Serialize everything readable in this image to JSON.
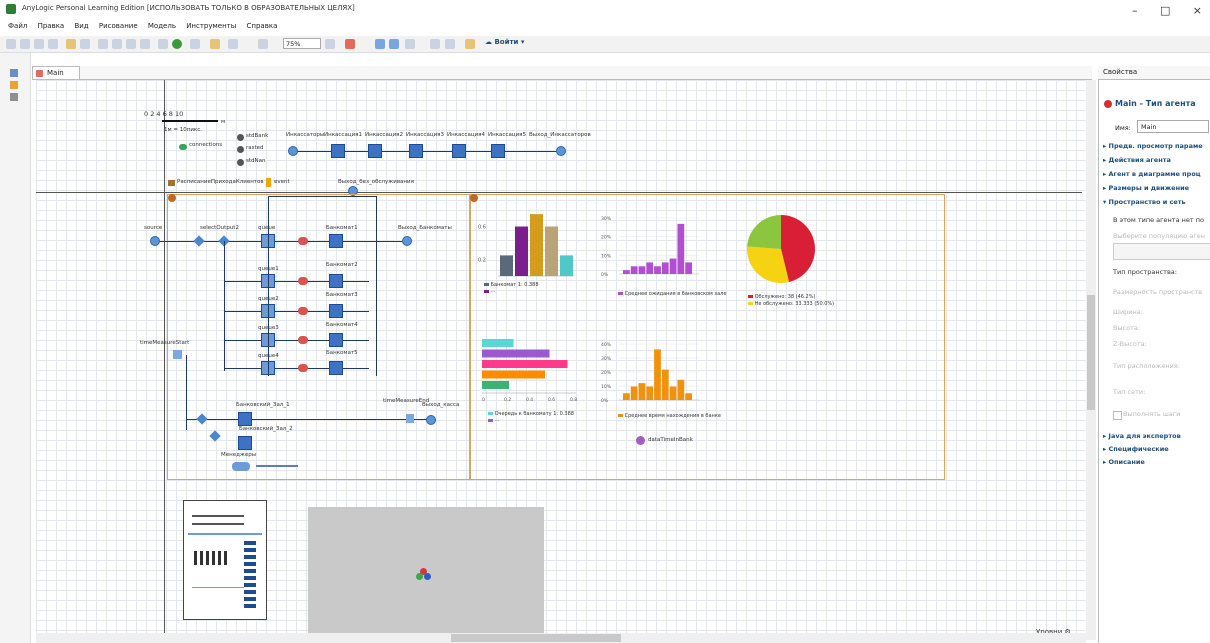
{
  "window": {
    "title": "AnyLogic Personal Learning Edition [ИСПОЛЬЗОВАТЬ ТОЛЬКО В ОБРАЗОВАТЕЛЬНЫХ ЦЕЛЯХ]",
    "controls": [
      "–",
      "□",
      "×"
    ]
  },
  "menu": [
    "Файл",
    "Правка",
    "Вид",
    "Рисование",
    "Модель",
    "Инструменты",
    "Справка"
  ],
  "toolbar": {
    "zoom": "75%",
    "login": "Войти"
  },
  "editor_tab": {
    "label": "Main"
  },
  "scale": {
    "ticks": "0   2  4  6  8    10",
    "unit": "м",
    "ratio": "1м = 10пикс."
  },
  "legend_icons": {
    "connections": "connections",
    "stdBank": "stdBank",
    "rasted": "rasted",
    "stdNan": "stdNan"
  },
  "collectors": {
    "start": "Инкассаторы",
    "stops": [
      "Инкассация1",
      "Инкассация2",
      "Инкассация3",
      "Инкассация4",
      "Инкассация5"
    ],
    "end": "Выход_Инкассаторов"
  },
  "events": {
    "schedule": "РасписаниеПриходаКлиентов",
    "event": "event",
    "exit_no_service": "Выход_без_обслуживания"
  },
  "flow": {
    "source": "source",
    "select": "selectOutput2",
    "queues": [
      "queue",
      "queue1",
      "queue2",
      "queue3",
      "queue4"
    ],
    "banks": [
      "Банкомат1",
      "Банкомат2",
      "Банкомат3",
      "Банкомат4",
      "Банкомат5"
    ],
    "exit_bank": "Выход_Банкоматы",
    "measure_start": "timeMeasureStart",
    "measure_end": "timeMeasureEnd",
    "exit_cash": "Выход_касса",
    "cash1": "Банковский_Зал_1",
    "cash2": "Банковский_Зал_2",
    "managers": "Менеджеры"
  },
  "charts": {
    "bar_legend": [
      "Банкомат 1: 0.388",
      "···"
    ],
    "hist1_legend": "Среднее ожидания в банковском зале",
    "pie_legend": [
      "Обслужено: 38 (46.2%)",
      "Не обслужено: 33.333 (50.0%)"
    ],
    "hbar_legend": [
      "Очередь к банкомату 1: 0.388",
      "···"
    ],
    "hist2_legend": "Среднее время нахождения в банке",
    "dataset": "dataTimeInBank"
  },
  "chart_data": [
    {
      "type": "bar",
      "values": [
        0.25,
        0.6,
        0.75,
        0.6,
        0.25
      ],
      "ylim": [
        0,
        0.8
      ],
      "yticks": [
        "0.2",
        "0.6"
      ]
    },
    {
      "type": "bar",
      "values": [
        1,
        2,
        2,
        3,
        2,
        3,
        4,
        13,
        3
      ],
      "yticks": [
        "0%",
        "10%",
        "20%",
        "30%"
      ]
    },
    {
      "type": "pie",
      "values": [
        46.2,
        30.0,
        23.8
      ]
    },
    {
      "type": "bar",
      "orientation": "horizontal",
      "values": [
        0.35,
        0.75,
        0.95,
        0.7,
        0.3
      ],
      "xticks": [
        "0",
        "0.2",
        "0.4",
        "0.6",
        "0.8"
      ]
    },
    {
      "type": "bar",
      "values": [
        2,
        4,
        5,
        4,
        15,
        9,
        4,
        6,
        2
      ],
      "yticks": [
        "0%",
        "10%",
        "20%",
        "30%",
        "40%"
      ]
    }
  ],
  "colors": {
    "bars": [
      "#5a6a7a",
      "#7b1f8f",
      "#d59b1d",
      "#b8a37a",
      "#4fc9c6"
    ],
    "hist1": "#b24fd0",
    "hist2": "#f0920e",
    "pie": [
      "#d81f36",
      "#f5d312",
      "#8cc63f"
    ],
    "hbars": [
      "#5bd6d6",
      "#9b59d0",
      "#ff3a8c",
      "#ff8c00",
      "#3cb371"
    ]
  },
  "footer": {
    "levels": "Уровни"
  },
  "properties": {
    "tab": "Свойства",
    "title": "Main - Тип агента",
    "name_label": "Имя:",
    "name_value": "Main",
    "sections_top": [
      "Предв. просмотр параме",
      "Действия агента",
      "Агент в диаграмме проц",
      "Размеры и движение",
      "Пространство и сеть"
    ],
    "no_pop_text": "В этом типе агента нет по",
    "select_pop": "Выберите популяцию аген",
    "space_type": "Тип пространства:",
    "fields": [
      "Размерность пространств",
      "Ширина:",
      "Высота:",
      "Z-Высота:",
      "Тип расположения:",
      "Тип сети:"
    ],
    "checkbox": "Выполнять шаги",
    "sections_bottom": [
      "Java для экспертов",
      "Специфические",
      "Описание"
    ]
  }
}
